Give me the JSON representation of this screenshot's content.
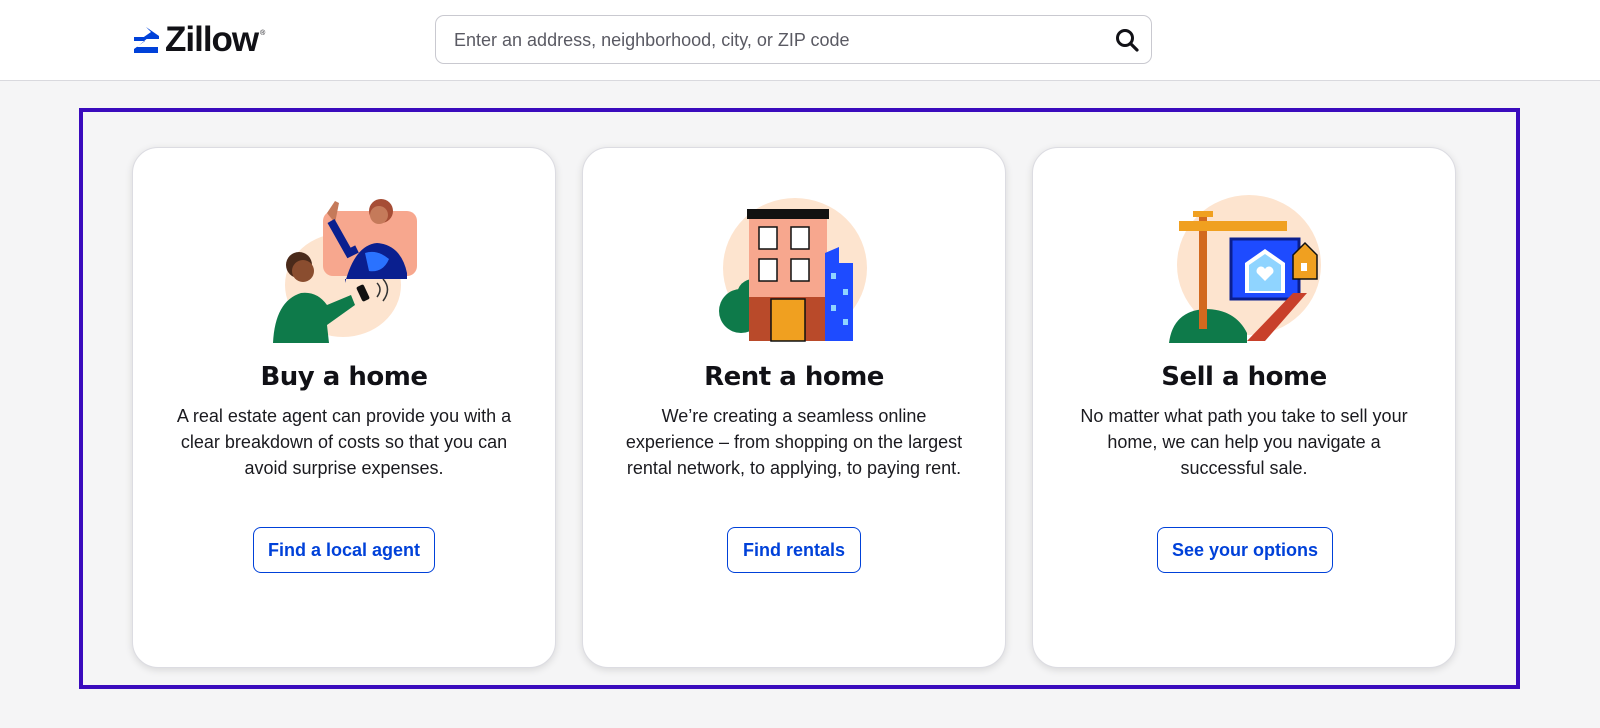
{
  "header": {
    "logo_text": "Zillow",
    "search_placeholder": "Enter an address, neighborhood, city, or ZIP code"
  },
  "cards": [
    {
      "title": "Buy a home",
      "description": "A real estate agent can provide you with a clear breakdown of costs so that you can avoid surprise expenses.",
      "button": "Find a local agent",
      "icon": "agent-video-call-illustration"
    },
    {
      "title": "Rent a home",
      "description": "We’re creating a seamless online experience – from shopping on the largest rental network, to applying, to paying rent.",
      "button": "Find rentals",
      "icon": "apartment-building-illustration"
    },
    {
      "title": "Sell a home",
      "description": "No matter what path you take to sell your home, we can help you navigate a successful sale.",
      "button": "See your options",
      "icon": "for-sale-sign-illustration"
    }
  ],
  "colors": {
    "brand_blue": "#0041d9",
    "highlight_border": "#3a0bbd",
    "page_bg": "#f5f5f6"
  }
}
